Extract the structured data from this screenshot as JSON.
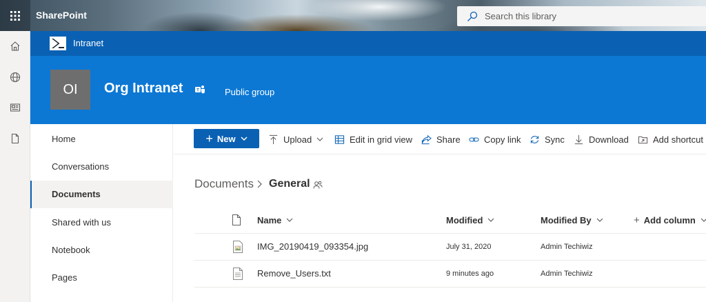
{
  "suite": {
    "app_name": "SharePoint",
    "search_placeholder": "Search this library"
  },
  "hub": {
    "title": "Intranet"
  },
  "site": {
    "logo_initials": "OI",
    "title": "Org Intranet",
    "group_type": "Public group"
  },
  "left_nav": {
    "items": [
      {
        "label": "Home"
      },
      {
        "label": "Conversations"
      },
      {
        "label": "Documents",
        "active": true
      },
      {
        "label": "Shared with us"
      },
      {
        "label": "Notebook"
      },
      {
        "label": "Pages"
      }
    ]
  },
  "command_bar": {
    "new_label": "New",
    "upload_label": "Upload",
    "grid_label": "Edit in grid view",
    "share_label": "Share",
    "copy_link_label": "Copy link",
    "sync_label": "Sync",
    "download_label": "Download",
    "add_shortcut_label": "Add shortcut"
  },
  "breadcrumb": {
    "root": "Documents",
    "current": "General"
  },
  "table": {
    "columns": {
      "name": "Name",
      "modified": "Modified",
      "modified_by": "Modified By",
      "add_column": "Add column"
    },
    "rows": [
      {
        "name": "IMG_20190419_093354.jpg",
        "modified": "July 31, 2020",
        "modified_by": "Admin Techiwiz",
        "type_icon": "image-file-icon"
      },
      {
        "name": "Remove_Users.txt",
        "modified": "9 minutes ago",
        "modified_by": "Admin Techiwiz",
        "type_icon": "text-file-icon"
      }
    ]
  },
  "colors": {
    "hub_blue": "#0a61b4",
    "header_blue": "#0c78d4",
    "logo_gray": "#6e6e6e",
    "accent": "#0a61b4"
  }
}
